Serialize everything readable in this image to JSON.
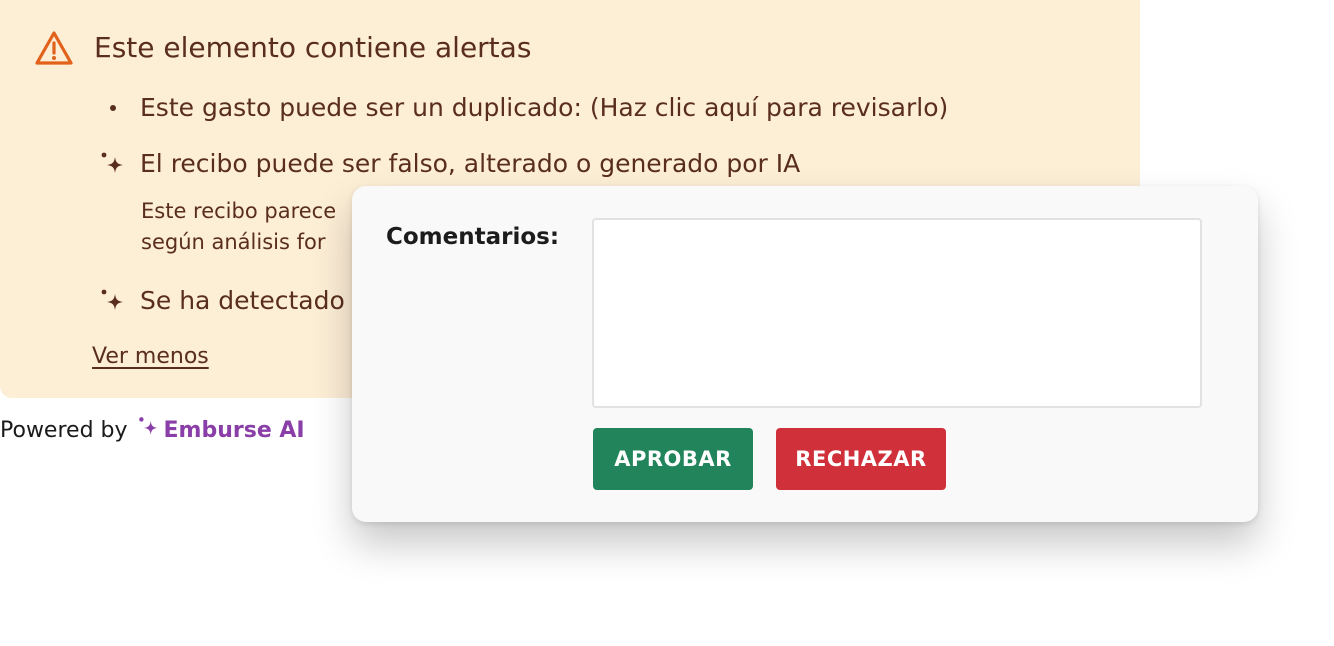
{
  "alert": {
    "title": "Este elemento contiene alertas",
    "items": [
      {
        "text": "Este gasto puede ser un duplicado: (Haz clic aquí para revisarlo)",
        "icon": "bullet-dot"
      },
      {
        "text": "El recibo puede ser falso, alterado o generado por IA",
        "icon": "sparkle-icon",
        "subtext_lines": [
          "Este recibo parece",
          "según análisis for"
        ]
      },
      {
        "text": "Se ha detectado",
        "icon": "sparkle-icon"
      }
    ],
    "toggle_label": "Ver menos",
    "colors": {
      "background": "#fdeed6",
      "text": "#5a2e1e",
      "warning": "#e2621b"
    }
  },
  "footer": {
    "powered_prefix": "Powered by",
    "brand_name": "Emburse AI",
    "brand_color": "#8a3ea8"
  },
  "comments": {
    "label": "Comentarios:",
    "value": "",
    "approve_label": "APROBAR",
    "reject_label": "RECHAZAR",
    "colors": {
      "approve": "#22845a",
      "reject": "#d0303a"
    }
  }
}
